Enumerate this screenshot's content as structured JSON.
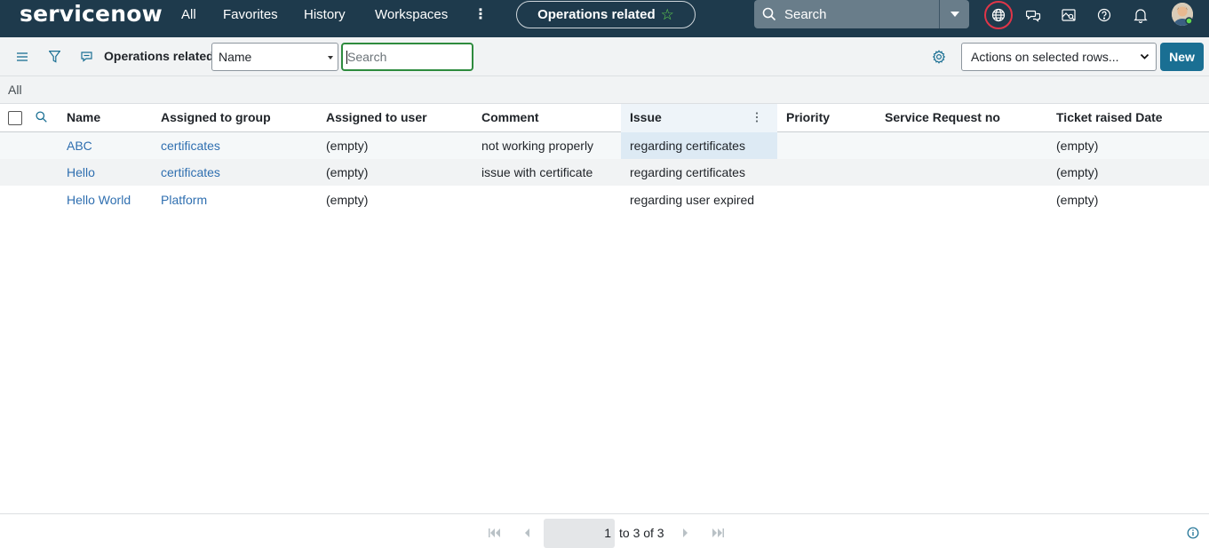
{
  "app": {
    "logo_text": "servicenow"
  },
  "topnav": {
    "links": [
      {
        "label": "All"
      },
      {
        "label": "Favorites"
      },
      {
        "label": "History"
      },
      {
        "label": "Workspaces"
      }
    ],
    "context_pill": "Operations related",
    "search_placeholder": "Search",
    "icons": [
      "globe-icon",
      "chat-icon",
      "picture-search-icon",
      "help-icon",
      "bell-icon",
      "avatar"
    ],
    "accent_ring_color": "#e03548"
  },
  "toolbar": {
    "list_title": "Operations related",
    "field_select_value": "Name",
    "search_placeholder": "Search",
    "actions_select_value": "Actions on selected rows...",
    "new_label": "New"
  },
  "breadcrumb": {
    "label": "All"
  },
  "table": {
    "columns": [
      "Name",
      "Assigned to group",
      "Assigned to user",
      "Comment",
      "Issue",
      "Priority",
      "Service Request no",
      "Ticket raised Date"
    ],
    "rows": [
      {
        "name": "ABC",
        "group": "certificates",
        "user": "(empty)",
        "comment": "not working properly",
        "issue": "regarding certificates",
        "priority": "",
        "srno": "",
        "date": "(empty)"
      },
      {
        "name": "Hello",
        "group": "certificates",
        "user": "(empty)",
        "comment": "issue with certificate",
        "issue": "regarding certificates",
        "priority": "",
        "srno": "",
        "date": "(empty)"
      },
      {
        "name": "Hello World",
        "group": "Platform",
        "user": "(empty)",
        "comment": "",
        "issue": "regarding user expired",
        "priority": "",
        "srno": "",
        "date": "(empty)"
      }
    ]
  },
  "pagination": {
    "current_page": "1",
    "range_text": "to 3 of 3"
  },
  "colors": {
    "nav_bg": "#1e3a4c",
    "link": "#2f6fb0",
    "primary_button": "#1a6f93",
    "star": "#62d84e",
    "search_focus": "#2e8b3e"
  }
}
